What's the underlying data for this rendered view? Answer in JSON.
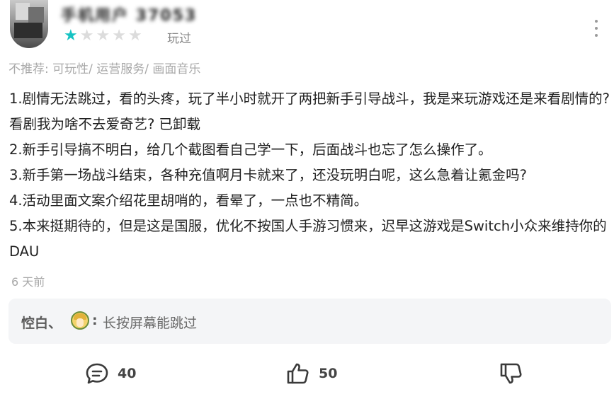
{
  "user": {
    "name": "手机用户 3705370",
    "rating": 1,
    "max_rating": 5,
    "status": "玩过"
  },
  "tags": "不推荐: 可玩性/ 运营服务/ 画面音乐",
  "review": {
    "paragraphs": [
      "1.剧情无法跳过，看的头疼，玩了半小时就开了两把新手引导战斗，我是来玩游戏还是来看剧情的?看剧我为啥不去爱奇艺? 已卸载",
      "2.新手引导搞不明白，给几个截图看自己学一下，后面战斗也忘了怎么操作了。",
      "3.新手第一场战斗结束，各种充值啊月卡就来了，还没玩明白呢，这么急着让氪金吗?",
      "4.活动里面文案介绍花里胡哨的，看晕了，一点也不精简。",
      "5.本来挺期待的，但是这是国服，优化不按国人手游习惯来，迟早这游戏是Switch小众来维持你的DAU"
    ]
  },
  "time": "6 天前",
  "reply": {
    "author": "悾白、",
    "colon": ":",
    "text": "长按屏幕能跳过"
  },
  "actions": {
    "comments": "40",
    "likes": "50"
  },
  "colors": {
    "star_on": "#16c3c3",
    "star_off": "#dcdcdc",
    "muted_text": "#a8a8a8"
  }
}
